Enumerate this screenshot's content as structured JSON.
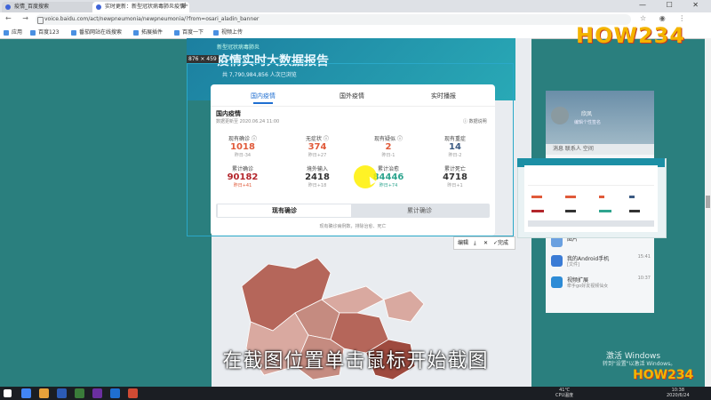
{
  "browser": {
    "tabs": [
      {
        "title": "疫情_百度搜索"
      },
      {
        "title": "实时更新：新型冠状病毒肺炎疫情"
      }
    ],
    "new_tab": "+",
    "window_controls": "— ☐ ✕",
    "nav": "← → ↻",
    "url": "voice.baidu.com/act/newpneumonia/newpneumonia/?from=osari_aladin_banner",
    "toolbar_icons": "☆ ◉ ⋮",
    "bookmarks": [
      "应用",
      "百度123",
      "番茄网站在线搜索",
      "拓展插件",
      "百度一下",
      "视频上传"
    ]
  },
  "page": {
    "header_sub": "新型冠状病毒肺炎",
    "header_title": "疫情实时大数据报告",
    "header_line": "共 7,790,984,856 人次已浏览",
    "dims_label": "876 × 459",
    "tabs": [
      "国内疫情",
      "国外疫情",
      "实时播报"
    ],
    "section_title": "国内疫情",
    "updated": "数据更新至 2020.06.24 11:00",
    "explain": "ⓘ 数据说明",
    "stats": [
      {
        "label": "现有确诊 ⓘ",
        "value": "1018",
        "delta": "昨日-34",
        "color": "#e05a3a"
      },
      {
        "label": "无症状 ⓘ",
        "value": "374",
        "delta": "昨日+27",
        "color": "#e05a3a"
      },
      {
        "label": "现有疑似 ⓘ",
        "value": "2",
        "delta": "昨日-1",
        "color": "#e05a3a"
      },
      {
        "label": "现有重症",
        "value": "14",
        "delta": "昨日-2",
        "color": "#3b5a82"
      },
      {
        "label": "累计确诊",
        "value": "90182",
        "delta": "昨日+41",
        "color": "#b3262c"
      },
      {
        "label": "境外输入",
        "value": "2418",
        "delta": "昨日+18",
        "color": "#333333"
      },
      {
        "label": "累计治愈",
        "value": "84446",
        "delta": "昨日+74",
        "color": "#2fa58f"
      },
      {
        "label": "累计死亡",
        "value": "4718",
        "delta": "昨日+1",
        "color": "#333333"
      }
    ],
    "button_current": "现有确诊",
    "button_total": "累计确诊",
    "note": "现有确诊病例数，排除治愈、死亡",
    "snap_toolbar": {
      "edit": "编辑",
      "done": "完成"
    }
  },
  "qq": {
    "name": "欣凤",
    "signature": "编辑个性签名",
    "tabs": "消息  联系人  空间",
    "items": [
      {
        "title": "图片",
        "sub": "",
        "time": ""
      },
      {
        "title": "我的Android手机",
        "sub": "[文件]",
        "time": "15:41"
      },
      {
        "title": "视频扩展",
        "sub": "牵手go好友视频仙女",
        "time": "10:37"
      }
    ]
  },
  "logo_text": "HOW234",
  "subtitle": "在截图位置单击鼠标开始截图",
  "activate": {
    "line1": "激活 Windows",
    "line2": "转到\"设置\"以激活 Windows。"
  },
  "taskbar": {
    "temp": "41℃",
    "cpu": "CPU温度",
    "time": "10:38",
    "date": "2020/6/24"
  }
}
